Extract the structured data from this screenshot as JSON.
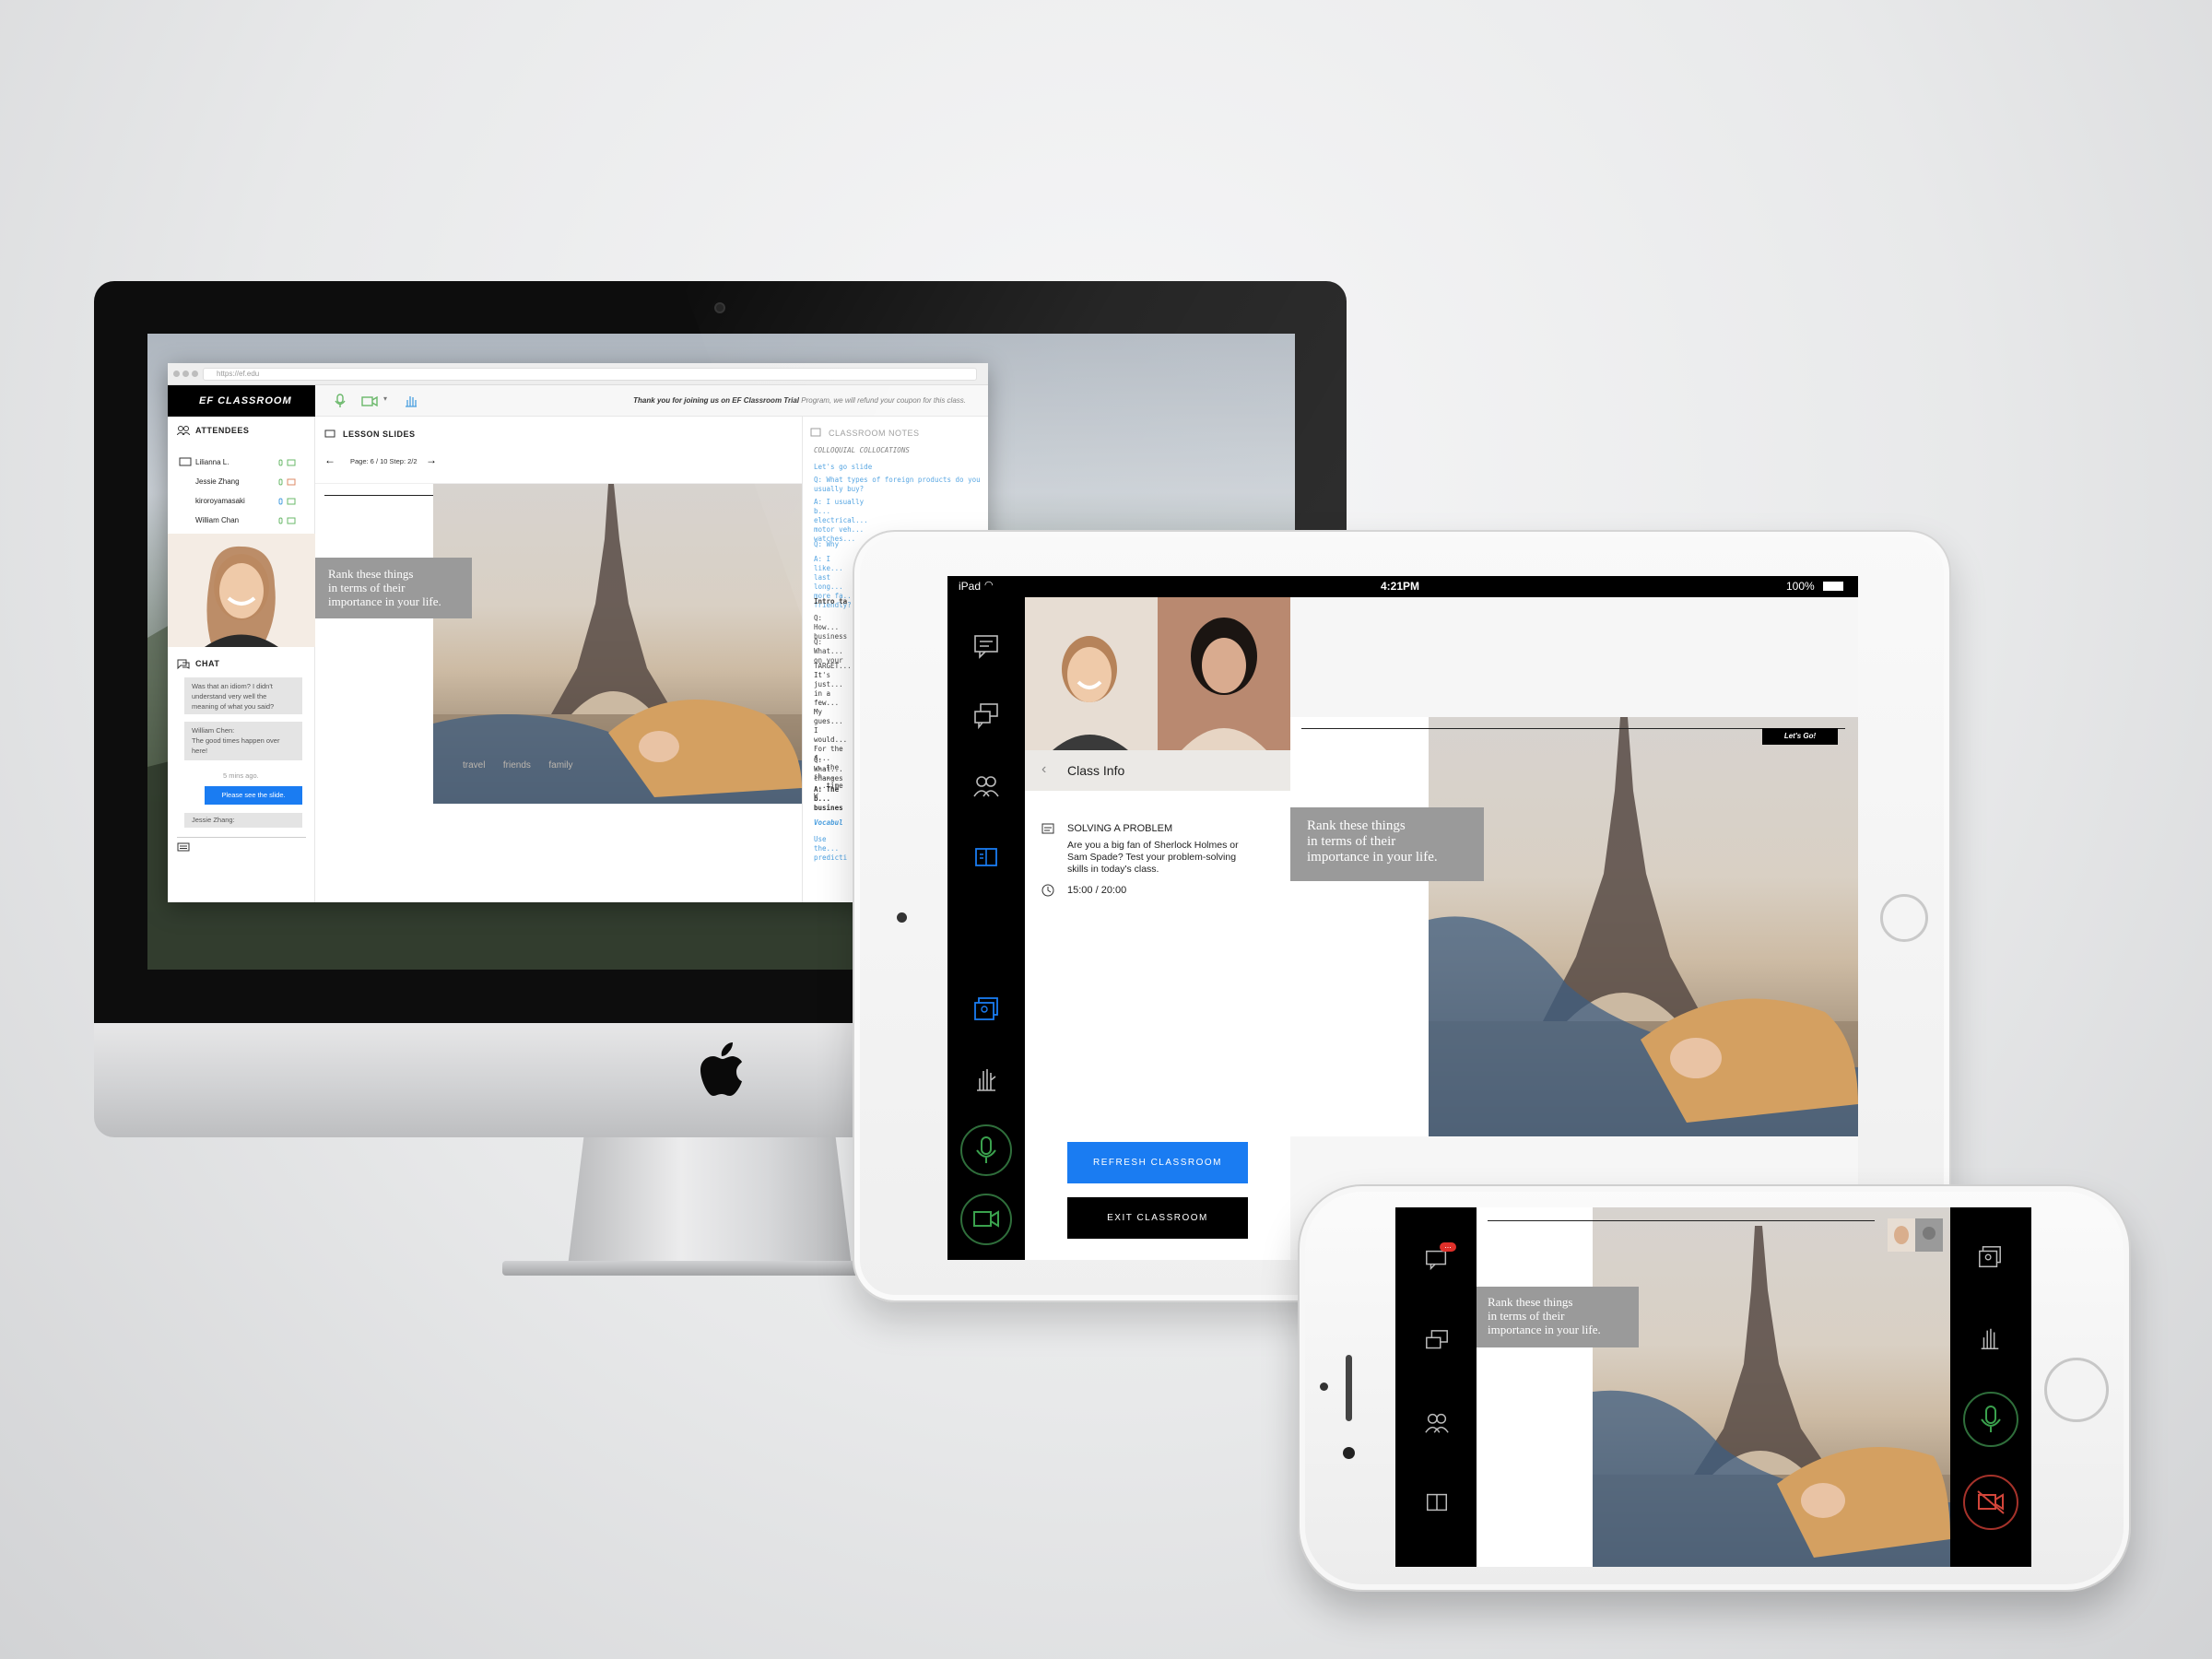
{
  "desktop": {
    "browser": {
      "url": "https://ef.edu",
      "brand": "EF CLASSROOM",
      "notice_bold": "Thank you for joining us on EF Classroom Trial",
      "notice_rest": " Program, we will refund your coupon for this class."
    },
    "attendees": {
      "title": "ATTENDEES",
      "people": [
        "Lilianna L.",
        "Jessie Zhang",
        "kiroroyamasaki",
        "William Chan"
      ]
    },
    "chat": {
      "title": "CHAT",
      "messages": [
        "Was that an idiom? I didn't understand very well the meaning of what you said?",
        "William Chen:",
        "The good times happen over here!",
        "5 mins ago.",
        "Please see the slide.",
        "Jessie Zhang:"
      ]
    },
    "lesson": {
      "title": "LESSON SLIDES",
      "pager": "Page: 6 / 10 Step: 2/2",
      "slide_words": "travel       friends       family"
    },
    "notes": {
      "title": "CLASSROOM NOTES",
      "lines": [
        "COLLOQUIAL COLLOCATIONS",
        "Let's go slide",
        "Q: What types of foreign products do you usually buy?",
        "A: I usually b... electrical... motor veh... watches...",
        "Q: Why",
        "A: I like... last long... more fa... friendly?",
        "Intro ta",
        "Q: How... business",
        "Q: What... on your",
        "TARGET... It's just... in a few... My gues... I would... For the f... ...the sh... ...time w",
        "Q: What... changes",
        "A: The b... busines",
        "Vocabul",
        "Use the... predicti"
      ]
    }
  },
  "slide": {
    "rank_text": [
      "Rank these things",
      "in terms of their",
      "importance in your life."
    ],
    "button": "Let's Go!"
  },
  "tablet": {
    "status": {
      "device": "iPad",
      "time": "4:21PM",
      "battery": "100%"
    },
    "class_info": {
      "title": "Class Info",
      "lesson_title": "SOLVING A PROBLEM",
      "description": "Are you a big fan of Sherlock Holmes or Sam Spade? Test your problem-solving skills in today's class.",
      "time": "15:00 / 20:00"
    },
    "refresh_button": "REFRESH CLASSROOM",
    "exit_button": "EXIT CLASSROOM"
  },
  "phone": {
    "chat_badge": "..."
  },
  "colors": {
    "accent_blue": "#1a7cf2",
    "mic_green": "#2f6e3b",
    "video_off_red": "#c0392b",
    "rank_box": "#9a9a9a"
  }
}
